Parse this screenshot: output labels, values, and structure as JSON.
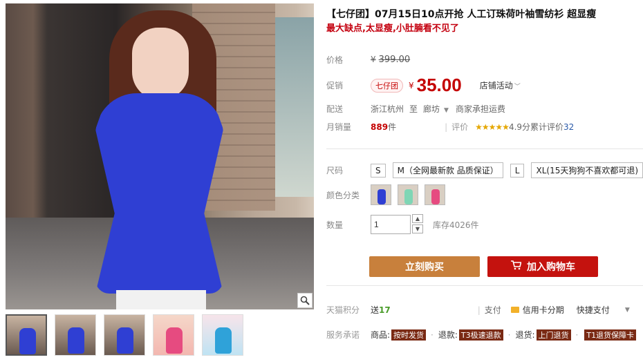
{
  "gallery": {
    "zoom_icon": "magnifier-icon",
    "thumbnails": [
      "blue-dress-photo-1",
      "blue-dress-photo-2",
      "blue-dress-photo-3",
      "pink-dress-photo",
      "promo-banner-photo"
    ]
  },
  "product": {
    "title": "【七仔团】07月15日10点开抢 人工订珠荷叶袖雪纺衫 超显瘦",
    "subtitle": "最大缺点,太显瘦,小肚腩看不见了"
  },
  "price": {
    "label": "价格",
    "currency": "¥",
    "original": "399.00"
  },
  "promo": {
    "label": "促销",
    "badge": "七仔团",
    "currency": "¥",
    "price": "35.00",
    "store_activity": "店铺活动"
  },
  "shipping": {
    "label": "配送",
    "from": "浙江杭州",
    "to_word": "至",
    "destination": "廊坊",
    "fee": "商家承担运费"
  },
  "sales": {
    "label": "月销量",
    "count": "889",
    "unit": "件",
    "rating_label": "评价",
    "stars": "★★★★★",
    "score": "4.9分",
    "total_reviews_label": "累计评价",
    "total_reviews": "32"
  },
  "size": {
    "label": "尺码",
    "options": [
      "S",
      "M（全网最新款 品质保证）",
      "L",
      "XL(15天狗狗不喜欢都可退)"
    ]
  },
  "color": {
    "label": "颜色分类",
    "swatches": [
      "blue",
      "mint",
      "pink"
    ]
  },
  "quantity": {
    "label": "数量",
    "value": "1",
    "stock": "库存4026件"
  },
  "buttons": {
    "buy_now": "立刻购买",
    "add_to_cart": "加入购物车"
  },
  "points": {
    "label": "天猫积分",
    "send_word": "送",
    "value": "17",
    "pay_label": "支付",
    "credit_card": "信用卡分期",
    "quick_pay": "快捷支付"
  },
  "service": {
    "label": "服务承诺",
    "goods_prefix": "商品:",
    "goods_tag": "按时发货",
    "refund_prefix": "退款:",
    "refund_tag": "T3极速退款",
    "return_prefix": "退货:",
    "return_tag": "上门退货",
    "insurance_tag": "T1退货保障卡"
  },
  "colors": {
    "price_red": "#c40000",
    "buy_button": "#c8803c",
    "cart_button": "#c4120e",
    "star_gold": "#e5a700"
  }
}
